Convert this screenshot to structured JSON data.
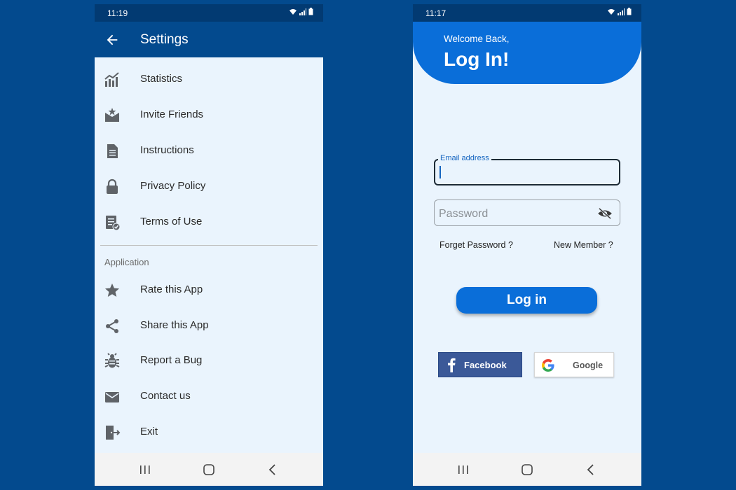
{
  "settings_screen": {
    "status_time": "11:19",
    "title": "Settings",
    "items": [
      {
        "label": "Statistics",
        "icon": "statistics-icon"
      },
      {
        "label": "Invite Friends",
        "icon": "invite-icon"
      },
      {
        "label": "Instructions",
        "icon": "document-icon"
      },
      {
        "label": "Privacy Policy",
        "icon": "lock-icon"
      },
      {
        "label": "Terms of Use",
        "icon": "terms-icon"
      }
    ],
    "section_header": "Application",
    "app_items": [
      {
        "label": "Rate this App",
        "icon": "star-icon"
      },
      {
        "label": "Share this App",
        "icon": "share-icon"
      },
      {
        "label": "Report a Bug",
        "icon": "bug-icon"
      },
      {
        "label": "Contact us",
        "icon": "mail-icon"
      },
      {
        "label": "Exit",
        "icon": "exit-icon"
      }
    ]
  },
  "login_screen": {
    "status_time": "11:17",
    "welcome": "Welcome Back,",
    "title": "Log In!",
    "email_label": "Email address",
    "password_placeholder": "Password",
    "forget_password": "Forget Password ?",
    "new_member": "New Member ?",
    "login_button": "Log in",
    "facebook_label": "Facebook",
    "google_label": "Google"
  },
  "colors": {
    "background": "#034a8e",
    "app_bar": "#034a8e",
    "accent": "#0a6ed9",
    "facebook": "#3b5998",
    "screen_background": "#eaf4fd"
  }
}
